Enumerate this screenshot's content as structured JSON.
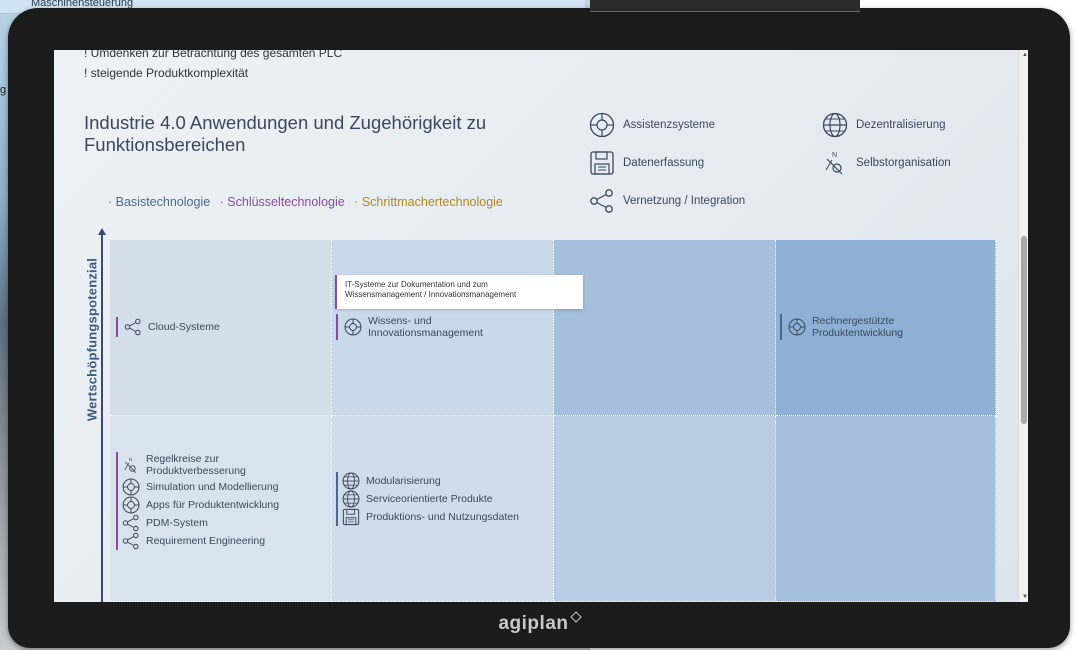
{
  "background": {
    "left_window_title": "Maschinensteuerung",
    "left_window_side_text": "g"
  },
  "brand": {
    "name": "agiplan"
  },
  "page": {
    "bullets": [
      "! Umdenken zur Betrachtung des gesamten PLC",
      "! steigende Produktkomplexität"
    ],
    "headline": "Industrie 4.0 Anwendungen und Zugehörigkeit zu Funktionsbereichen",
    "legend": {
      "basis": "· Basistechnologie",
      "schluessel": "· Schlüsseltechnologie",
      "schrittmacher": "· Schrittmachertechnologie"
    },
    "categories": [
      {
        "label": "Assistenzsysteme",
        "icon": "steering-wheel-icon"
      },
      {
        "label": "Dezentralisierung",
        "icon": "globe-icon"
      },
      {
        "label": "Datenerfassung",
        "icon": "floppy-disk-icon"
      },
      {
        "label": "Selbstorganisation",
        "icon": "compass-icon"
      },
      {
        "label": "Vernetzung / Integration",
        "icon": "network-icon"
      }
    ],
    "y_axis_label": "Wertschöpfungspotenzial",
    "tooltip": {
      "line1": "IT-Systeme zur Dokumentation und zum",
      "line2": "Wissensmanagement / Innovationsmanagement"
    },
    "grid": {
      "row0": {
        "col0": {
          "label": "Cloud-Systeme",
          "icon": "network-icon",
          "type": "schluessel"
        },
        "col1": {
          "label": "Wissens- und Innovationsmanagement",
          "icon": "steering-wheel-icon",
          "type": "schluessel"
        },
        "col3": {
          "label": "Rechnergestützte Produktentwicklung",
          "icon": "steering-wheel-icon",
          "type": "basis"
        }
      },
      "row1": {
        "col0": [
          {
            "label": "Regelkreise zur Produktverbesserung",
            "icon": "compass-icon"
          },
          {
            "label": "Simulation und Modellierung",
            "icon": "steering-wheel-icon"
          },
          {
            "label": "Apps für Produktentwicklung",
            "icon": "steering-wheel-icon"
          },
          {
            "label": "PDM-System",
            "icon": "network-icon"
          },
          {
            "label": "Requirement Engineering",
            "icon": "network-icon"
          }
        ],
        "col1": [
          {
            "label": "Modularisierung",
            "icon": "globe-icon"
          },
          {
            "label": "Serviceorientierte Produkte",
            "icon": "globe-icon"
          },
          {
            "label": "Produktions- und Nutzungsdaten",
            "icon": "floppy-disk-icon"
          }
        ]
      }
    }
  },
  "colors": {
    "basis": "#4a6a8c",
    "schluessel": "#8a4aa0",
    "schrittmacher": "#b08a1a",
    "headline": "#3a4a5c",
    "axis": "#3e5a80"
  }
}
